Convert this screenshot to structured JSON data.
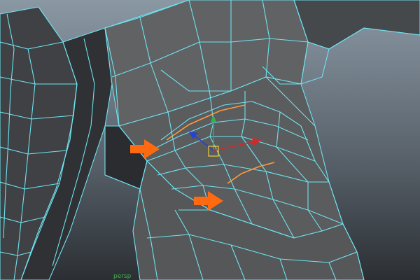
{
  "viewport": {
    "name": "maya-3d-viewport",
    "background_top": "#8a98a4",
    "background_bottom": "#2b2f34",
    "wireframe_color": "#6fe3f0",
    "selected_edge_color": "#ff9a3a",
    "annotation_arrow_color": "#ff6a10",
    "manipulator": {
      "y_axis_color": "#31b24a",
      "z_axis_color": "#2640d8",
      "x_axis_color": "#d22a2a",
      "center_color": "#e8d23a"
    },
    "corner_axis_label": "persp"
  }
}
